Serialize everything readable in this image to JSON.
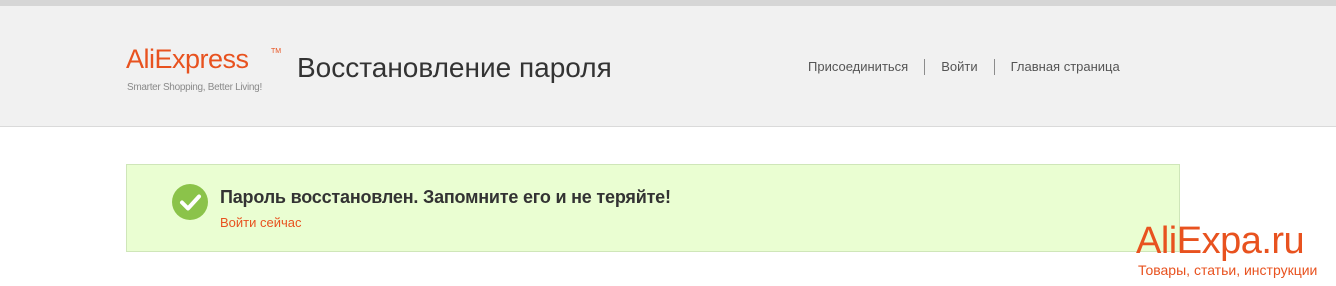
{
  "header": {
    "logo": {
      "brand": "AliExpress",
      "trademark": "TM",
      "tagline": "Smarter Shopping, Better Living!"
    },
    "title": "Восстановление пароля",
    "nav": [
      {
        "label": "Присоединиться"
      },
      {
        "label": "Войти"
      },
      {
        "label": "Главная страница"
      }
    ]
  },
  "message": {
    "icon": "check-circle-icon",
    "title": "Пароль восстановлен. Запомните его и не теряйте!",
    "link": "Войти сейчас"
  },
  "watermark": {
    "name": "AliExpa.ru",
    "tagline": "Товары, статьи, инструкции"
  },
  "colors": {
    "brand_orange": "#e8521f",
    "header_bg": "#f1f1f1",
    "success_bg": "#eafed2",
    "success_border": "#cfe6b9",
    "check_green": "#8bc34a"
  }
}
